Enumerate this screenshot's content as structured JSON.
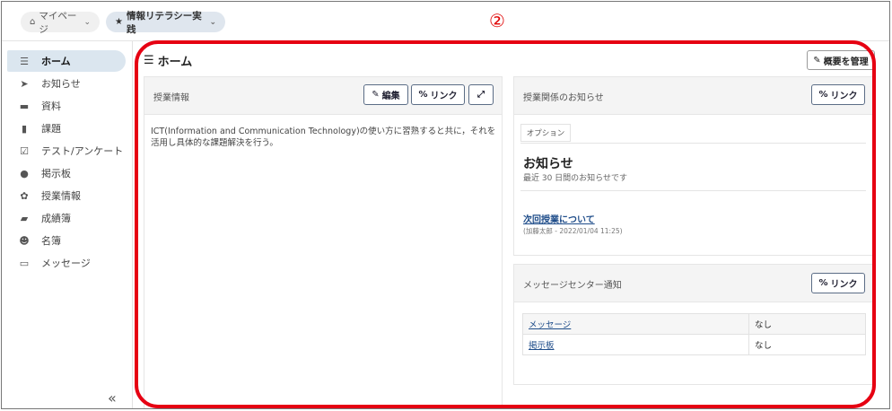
{
  "topbar": {
    "mypage_label": "マイページ",
    "course_label": "情報リテラシー実践",
    "annotation_number": "②"
  },
  "sidebar": {
    "items": [
      {
        "label": "ホーム",
        "icon": "list-icon",
        "glyph": "☰"
      },
      {
        "label": "お知らせ",
        "icon": "megaphone-icon",
        "glyph": "📢"
      },
      {
        "label": "資料",
        "icon": "folder-icon",
        "glyph": "▬"
      },
      {
        "label": "課題",
        "icon": "file-icon",
        "glyph": "▮"
      },
      {
        "label": "テスト/アンケート",
        "icon": "checkbox-icon",
        "glyph": "☑"
      },
      {
        "label": "掲示板",
        "icon": "comments-icon",
        "glyph": "●"
      },
      {
        "label": "授業情報",
        "icon": "gear-icon",
        "glyph": "✿"
      },
      {
        "label": "成績簿",
        "icon": "book-icon",
        "glyph": "▰"
      },
      {
        "label": "名簿",
        "icon": "users-icon",
        "glyph": "👥"
      },
      {
        "label": "メッセージ",
        "icon": "monitor-icon",
        "glyph": "▭"
      }
    ],
    "collapse_glyph": "«"
  },
  "main": {
    "title": "ホーム",
    "manage_button": "概要を管理"
  },
  "course_info": {
    "title": "授業情報",
    "edit_button": "編集",
    "link_button": "リンク",
    "expand_icon": "expand-icon",
    "text": "ICT(Information and Communication Technology)の使い方に習熟すると共に，それを活用し具体的な課題解決を行う。"
  },
  "notices": {
    "title": "授業関係のお知らせ",
    "link_button": "リンク",
    "option_label": "オプション",
    "heading": "お知らせ",
    "subheading": "最近 30 日間のお知らせです",
    "item_title": "次回授業について",
    "item_meta": "(加藤太郎 - 2022/01/04 11:25)"
  },
  "message_center": {
    "title": "メッセージセンター通知",
    "link_button": "リンク",
    "rows": [
      {
        "name": "メッセージ",
        "value": "なし"
      },
      {
        "name": "掲示板",
        "value": "なし"
      }
    ]
  },
  "colors": {
    "accent_outline": "#e60012",
    "link": "#1f4d8a",
    "active_nav_bg": "#dbe6ef"
  }
}
